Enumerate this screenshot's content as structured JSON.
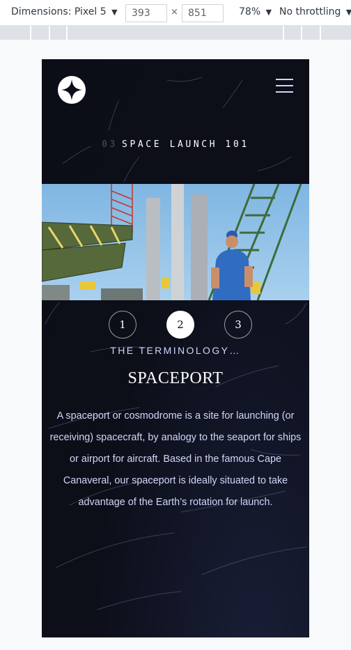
{
  "devtools": {
    "dimensions_label": "Dimensions: Pixel 5",
    "width": "393",
    "height": "851",
    "times": "×",
    "zoom": "78%",
    "throttle": "No throttling",
    "caret": "▼"
  },
  "page": {
    "heading_number": "03",
    "heading_text": "SPACE LAUNCH 101",
    "steps": [
      "1",
      "2",
      "3"
    ],
    "active_step": 2,
    "subtitle": "THE TERMINOLOGY…",
    "title": "SPACEPORT",
    "description": "A spaceport or cosmodrome is a site for launching (or receiving) spacecraft, by analogy to the seaport for ships or airport for aircraft. Based in the famous Cape Canaveral, our spaceport is ideally situated to take advantage of the Earth’s rotation for launch."
  },
  "colors": {
    "background": "#0b0d17",
    "accent_light": "#d0d6f9",
    "white": "#ffffff"
  },
  "icons": {
    "logo": "star-logo-icon",
    "menu": "hamburger-menu-icon"
  }
}
